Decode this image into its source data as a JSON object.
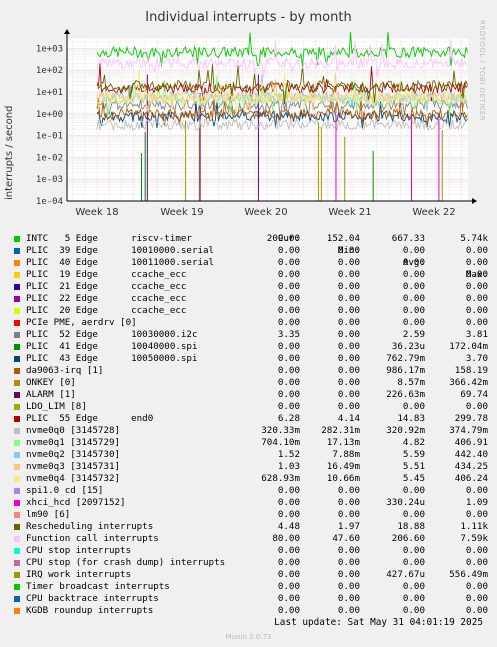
{
  "chart_data": {
    "type": "line",
    "title": "Individual interrupts - by month",
    "ylabel": "interrupts / second",
    "yscale": "log",
    "ylim": [
      0.0001,
      3000
    ],
    "y_ticks": [
      "1e+03",
      "1e+02",
      "1e+01",
      "1e+00",
      "1e-01",
      "1e-02",
      "1e-03",
      "1e-04"
    ],
    "x_ticks": [
      "Week 18",
      "Week 19",
      "Week 20",
      "Week 21",
      "Week 22"
    ],
    "grid": true,
    "series": [
      {
        "name": "INTC   5 Edge      riscv-timer",
        "color": "#00cc00",
        "cur": "209.00",
        "min": "152.04",
        "avg": "667.33",
        "max": "5.74k"
      },
      {
        "name": "PLIC  39 Edge      10010000.serial",
        "color": "#0066b3",
        "cur": "0.00",
        "min": "0.00",
        "avg": "0.00",
        "max": "0.00"
      },
      {
        "name": "PLIC  40 Edge      10011000.serial",
        "color": "#ff8000",
        "cur": "0.00",
        "min": "0.00",
        "avg": "0.00",
        "max": "0.00"
      },
      {
        "name": "PLIC  19 Edge      ccache_ecc",
        "color": "#ffcc00",
        "cur": "0.00",
        "min": "0.00",
        "avg": "0.00",
        "max": "0.00"
      },
      {
        "name": "PLIC  21 Edge      ccache_ecc",
        "color": "#330099",
        "cur": "0.00",
        "min": "0.00",
        "avg": "0.00",
        "max": "0.00"
      },
      {
        "name": "PLIC  22 Edge      ccache_ecc",
        "color": "#990099",
        "cur": "0.00",
        "min": "0.00",
        "avg": "0.00",
        "max": "0.00"
      },
      {
        "name": "PLIC  20 Edge      ccache_ecc",
        "color": "#ccff00",
        "cur": "0.00",
        "min": "0.00",
        "avg": "0.00",
        "max": "0.00"
      },
      {
        "name": "PCIe PME, aerdrv [0]",
        "color": "#ff0000",
        "cur": "0.00",
        "min": "0.00",
        "avg": "0.00",
        "max": "0.00"
      },
      {
        "name": "PLIC  52 Edge      10030000.i2c",
        "color": "#808080",
        "cur": "3.35",
        "min": "0.00",
        "avg": "2.59",
        "max": "3.81"
      },
      {
        "name": "PLIC  41 Edge      10040000.spi",
        "color": "#008f00",
        "cur": "0.00",
        "min": "0.00",
        "avg": "36.23u",
        "max": "172.04m"
      },
      {
        "name": "PLIC  43 Edge      10050000.spi",
        "color": "#00487d",
        "cur": "0.00",
        "min": "0.00",
        "avg": "762.79m",
        "max": "3.70"
      },
      {
        "name": "da9063-irq [1]",
        "color": "#b35a00",
        "cur": "0.00",
        "min": "0.00",
        "avg": "986.17m",
        "max": "158.19"
      },
      {
        "name": "ONKEY [0]",
        "color": "#b38f00",
        "cur": "0.00",
        "min": "0.00",
        "avg": "8.57m",
        "max": "366.42m"
      },
      {
        "name": "ALARM [1]",
        "color": "#6b006b",
        "cur": "0.00",
        "min": "0.00",
        "avg": "226.63m",
        "max": "69.74"
      },
      {
        "name": "LDO_LIM [8]",
        "color": "#8fb300",
        "cur": "0.00",
        "min": "0.00",
        "avg": "0.00",
        "max": "0.00"
      },
      {
        "name": "PLIC  55 Edge      end0",
        "color": "#b30000",
        "cur": "6.28",
        "min": "4.14",
        "avg": "14.83",
        "max": "299.78"
      },
      {
        "name": "nvme0q0 [3145728]",
        "color": "#bebebe",
        "cur": "320.33m",
        "min": "282.31m",
        "avg": "320.92m",
        "max": "374.79m"
      },
      {
        "name": "nvme0q1 [3145729]",
        "color": "#80ff80",
        "cur": "704.10m",
        "min": "17.13m",
        "avg": "4.82",
        "max": "406.91"
      },
      {
        "name": "nvme0q2 [3145730]",
        "color": "#80c9ff",
        "cur": "1.52",
        "min": "7.88m",
        "avg": "5.59",
        "max": "442.40"
      },
      {
        "name": "nvme0q3 [3145731]",
        "color": "#ffc080",
        "cur": "1.03",
        "min": "16.49m",
        "avg": "5.51",
        "max": "434.25"
      },
      {
        "name": "nvme0q4 [3145732]",
        "color": "#ffe680",
        "cur": "628.93m",
        "min": "10.66m",
        "avg": "5.45",
        "max": "406.24"
      },
      {
        "name": "spi1.0 cd [15]",
        "color": "#aa80ff",
        "cur": "0.00",
        "min": "0.00",
        "avg": "0.00",
        "max": "0.00"
      },
      {
        "name": "xhci_hcd [2097152]",
        "color": "#ee00cc",
        "cur": "0.00",
        "min": "0.00",
        "avg": "330.24u",
        "max": "1.09"
      },
      {
        "name": "lm90 [6]",
        "color": "#ff8080",
        "cur": "0.00",
        "min": "0.00",
        "avg": "0.00",
        "max": "0.00"
      },
      {
        "name": "Rescheduling interrupts",
        "color": "#666600",
        "cur": "4.48",
        "min": "1.97",
        "avg": "18.88",
        "max": "1.11k"
      },
      {
        "name": "Function call interrupts",
        "color": "#ffbfff",
        "cur": "80.00",
        "min": "47.60",
        "avg": "206.60",
        "max": "7.59k"
      },
      {
        "name": "CPU stop interrupts",
        "color": "#00ffcc",
        "cur": "0.00",
        "min": "0.00",
        "avg": "0.00",
        "max": "0.00"
      },
      {
        "name": "CPU stop (for crash dump) interrupts",
        "color": "#cc6699",
        "cur": "0.00",
        "min": "0.00",
        "avg": "0.00",
        "max": "0.00"
      },
      {
        "name": "IRQ work interrupts",
        "color": "#999900",
        "cur": "0.00",
        "min": "0.00",
        "avg": "427.67u",
        "max": "556.49m"
      },
      {
        "name": "Timer broadcast interrupts",
        "color": "#00cc00",
        "cur": "0.00",
        "min": "0.00",
        "avg": "0.00",
        "max": "0.00"
      },
      {
        "name": "CPU backtrace interrupts",
        "color": "#0066b3",
        "cur": "0.00",
        "min": "0.00",
        "avg": "0.00",
        "max": "0.00"
      },
      {
        "name": "KGDB roundup interrupts",
        "color": "#ff8000",
        "cur": "0.00",
        "min": "0.00",
        "avg": "0.00",
        "max": "0.00"
      }
    ]
  },
  "legend_headers": {
    "cur": "Cur:",
    "min": "Min:",
    "avg": "Avg:",
    "max": "Max:"
  },
  "side_label": "RRDTOOL / TOBI OETIKER",
  "last_update": "Last update: Sat May 31 04:01:19 2025",
  "footer": "Munin 2.0.73"
}
